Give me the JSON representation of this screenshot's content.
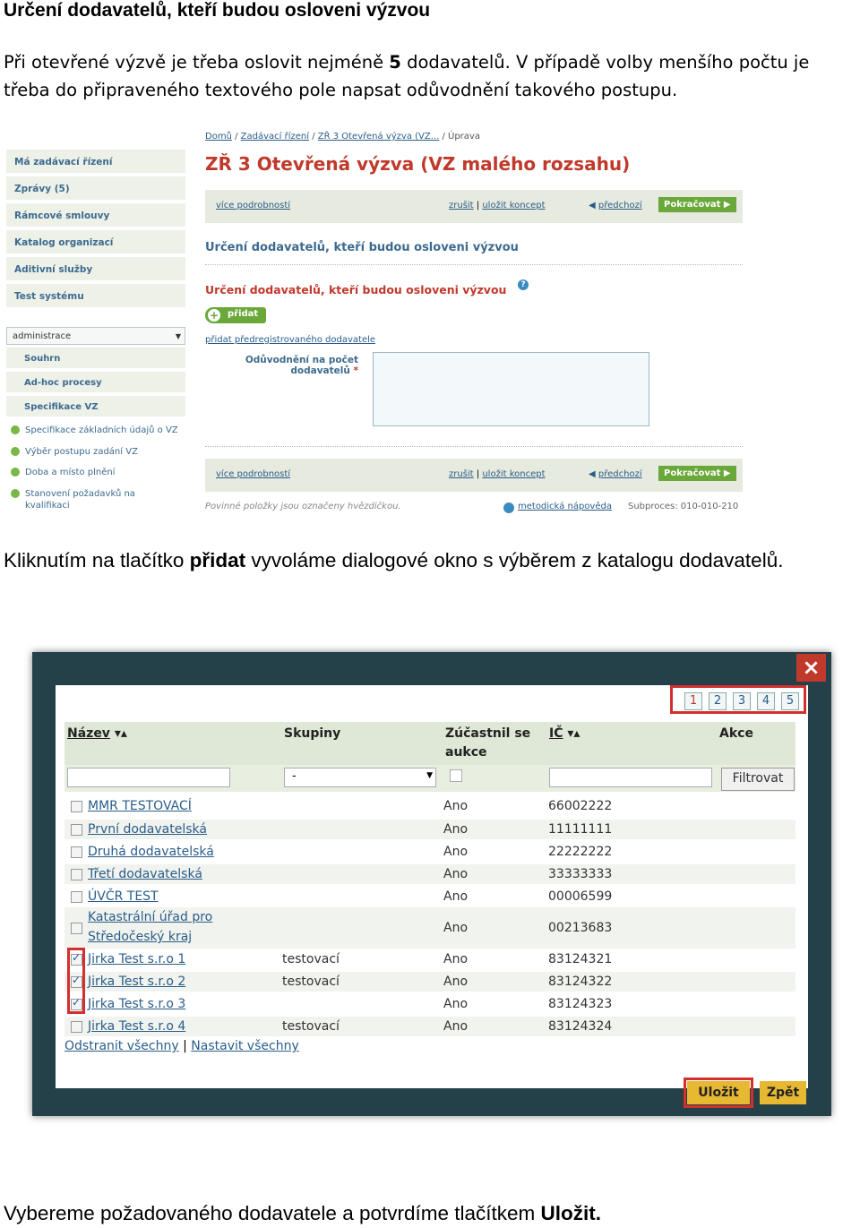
{
  "doc": {
    "heading": "Určení dodavatelů, kteří budou osloveni výzvou",
    "para_a": "Při otevřené výzvě je třeba oslovit nejméně ",
    "para_b": "5",
    "para_c": " dodavatelů. V případě volby menšího počtu je třeba do připraveného textového pole napsat odůvodnění takového postupu.",
    "cap1_a": "Kliknutím na tlačítko ",
    "cap1_b": "přidat",
    "cap1_c": " vyvoláme dialogové okno s výběrem z katalogu dodavatelů.",
    "cap2_a": "Vybereme požadovaného dodavatele a potvrdíme tlačítkem ",
    "cap2_b": "Uložit."
  },
  "shot1": {
    "sidebar": [
      "Má zadávací řízení",
      "Zprávy (5)",
      "Rámcové smlouvy",
      "Katalog organizací",
      "Aditivní služby",
      "Test systému"
    ],
    "admin_select": "administrace",
    "sub_items": [
      "Souhrn",
      "Ad-hoc procesy",
      "Specifikace VZ"
    ],
    "check_items": [
      "Specifikace základních údajů o VZ",
      "Výběr postupu zadání VZ",
      "Doba a místo plnění",
      "Stanovení požadavků na kvalifikaci"
    ],
    "breadcrumb": [
      "Domů",
      "Zadávací řízení",
      "ZŘ 3 Otevřená výzva (VZ...",
      "Úprava"
    ],
    "title": "ZŘ 3 Otevřená výzva (VZ malého rozsahu)",
    "bar": {
      "more": "více podrobností",
      "cancel": "zrušit",
      "save_draft": "uložit koncept",
      "prev": "předchozí",
      "continue": "Pokračovat"
    },
    "section_title": "Určení dodavatelů, kteří budou osloveni výzvou",
    "section_sub": "Určení dodavatelů, kteří budou osloveni výzvou",
    "add_label": "přidat",
    "prereg_link": "přidat předregistrovaného dodavatele",
    "justify_label": "Odůvodnění na počet dodavatelů",
    "required_note": "Povinné položky jsou označeny hvězdičkou.",
    "help_link": "metodická nápověda",
    "subprocess": "Subproces: 010-010-210"
  },
  "shot2": {
    "pages": [
      "1",
      "2",
      "3",
      "4",
      "5"
    ],
    "headers": {
      "name": "Název",
      "groups": "Skupiny",
      "auction": "Zúčastnil se aukce",
      "ic": "IČ",
      "actions": "Akce"
    },
    "group_select": "-",
    "filter_btn": "Filtrovat",
    "rows": [
      {
        "name": "MMR TESTOVACÍ",
        "group": "",
        "auction": "Ano",
        "ic": "66002222",
        "checked": false
      },
      {
        "name": "První dodavatelská",
        "group": "",
        "auction": "Ano",
        "ic": "11111111",
        "checked": false
      },
      {
        "name": "Druhá dodavatelská",
        "group": "",
        "auction": "Ano",
        "ic": "22222222",
        "checked": false
      },
      {
        "name": "Třetí dodavatelská",
        "group": "",
        "auction": "Ano",
        "ic": "33333333",
        "checked": false
      },
      {
        "name": "ÚVČR TEST",
        "group": "",
        "auction": "Ano",
        "ic": "00006599",
        "checked": false
      },
      {
        "name": "Katastrální úřad pro Středočeský kraj",
        "group": "",
        "auction": "Ano",
        "ic": "00213683",
        "checked": false
      },
      {
        "name": "Jirka Test s.r.o 1",
        "group": "testovací",
        "auction": "Ano",
        "ic": "83124321",
        "checked": true
      },
      {
        "name": "Jirka Test s.r.o 2",
        "group": "testovací",
        "auction": "Ano",
        "ic": "83124322",
        "checked": true
      },
      {
        "name": "Jirka Test s.r.o 3",
        "group": "",
        "auction": "Ano",
        "ic": "83124323",
        "checked": true
      },
      {
        "name": "Jirka Test s.r.o 4",
        "group": "testovací",
        "auction": "Ano",
        "ic": "83124324",
        "checked": false
      }
    ],
    "remove_all": "Odstranit všechny",
    "set_all": "Nastavit všechny",
    "save": "Uložit",
    "back": "Zpět"
  }
}
